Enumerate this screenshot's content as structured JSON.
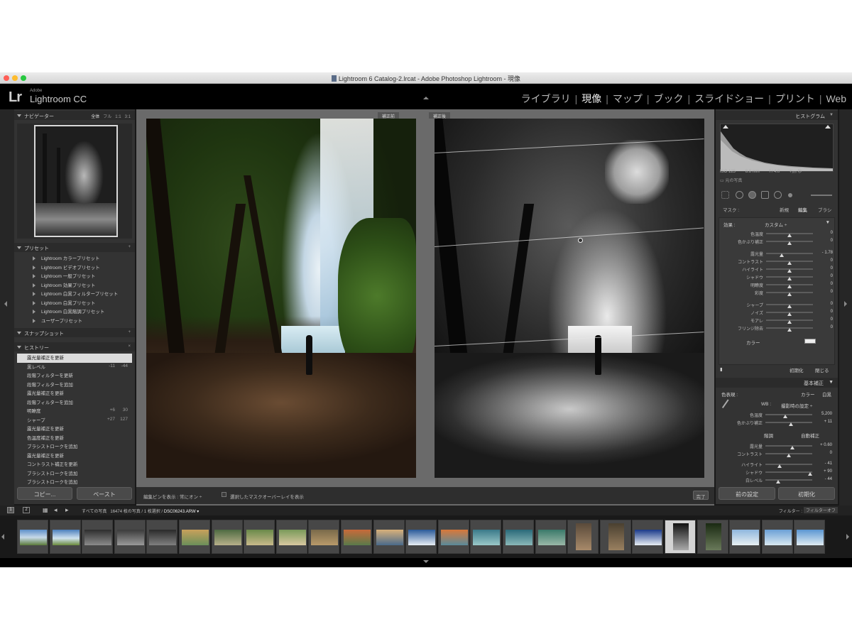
{
  "window": {
    "title": "Lightroom 6 Catalog-2.lrcat - Adobe Photoshop Lightroom - 現像",
    "traffic_colors": [
      "#ff5f57",
      "#febc2e",
      "#28c840"
    ]
  },
  "identity": {
    "logo": "Lr",
    "adobe": "Adobe",
    "product": "Lightroom CC"
  },
  "modules": [
    "ライブラリ",
    "現像",
    "マップ",
    "ブック",
    "スライドショー",
    "プリント",
    "Web"
  ],
  "active_module": "現像",
  "navigator": {
    "title": "ナビゲーター",
    "zoom": [
      "全体",
      "フル",
      "1:1",
      "3:1"
    ]
  },
  "presets": {
    "title": "プリセット",
    "items": [
      "Lightroom カラープリセット",
      "Lightroom ビデオプリセット",
      "Lightroom 一般プリセット",
      "Lightroom 効果プリセット",
      "Lightroom 白黒フィルタープリセット",
      "Lightroom 白黒プリセット",
      "Lightroom 白黒階調プリセット",
      "ユーザープリセット"
    ]
  },
  "snapshot": {
    "title": "スナップショット"
  },
  "history": {
    "title": "ヒストリー",
    "items": [
      {
        "label": "露光量補正を更新",
        "v1": "",
        "v2": "",
        "selected": true
      },
      {
        "label": "黒レベル",
        "v1": "-11",
        "v2": "-44"
      },
      {
        "label": "段階フィルターを更新",
        "v1": "",
        "v2": ""
      },
      {
        "label": "段階フィルターを追加",
        "v1": "",
        "v2": ""
      },
      {
        "label": "露光量補正を更新",
        "v1": "",
        "v2": ""
      },
      {
        "label": "段階フィルターを追加",
        "v1": "",
        "v2": ""
      },
      {
        "label": "明瞭度",
        "v1": "+6",
        "v2": "30"
      },
      {
        "label": "シャープ",
        "v1": "+27",
        "v2": "127"
      },
      {
        "label": "露光量補正を更新",
        "v1": "",
        "v2": ""
      },
      {
        "label": "色温度補正を更新",
        "v1": "",
        "v2": ""
      },
      {
        "label": "ブラシストロークを追加",
        "v1": "",
        "v2": ""
      },
      {
        "label": "露光量補正を更新",
        "v1": "",
        "v2": ""
      },
      {
        "label": "コントラスト補正を更新",
        "v1": "",
        "v2": ""
      },
      {
        "label": "ブラシストロークを追加",
        "v1": "",
        "v2": ""
      },
      {
        "label": "ブラシストロークを追加",
        "v1": "",
        "v2": ""
      }
    ]
  },
  "left_buttons": {
    "copy": "コピー...",
    "paste": "ペースト"
  },
  "view": {
    "before_label": "補正前",
    "after_label": "補正後"
  },
  "toolbar": {
    "pins_label": "編集ピンを表示 :",
    "pins_value": "常にオン ÷",
    "overlay_label": "選択したマスクオーバーレイを表示",
    "done": "完了"
  },
  "histogram": {
    "title": "ヒストグラム",
    "iso": "ISO 125",
    "focal": "8.8 mm",
    "aperture": "f / 4.0",
    "shutter": "¹⁄₁₆₀ 秒",
    "orig": "元の写真"
  },
  "mask": {
    "label": "マスク :",
    "new": "新規",
    "edit": "編集",
    "brush": "ブラシ"
  },
  "effect": {
    "label": "効果 :",
    "preset": "カスタム ÷",
    "sliders": [
      {
        "label": "色温度",
        "value": "0",
        "pos": 0.5,
        "group": 1
      },
      {
        "label": "色かぶり補正",
        "value": "0",
        "pos": 0.5,
        "group": 1
      },
      {
        "label": "露光量",
        "value": "- 1.78",
        "pos": 0.34,
        "group": 2
      },
      {
        "label": "コントラスト",
        "value": "0",
        "pos": 0.5,
        "group": 2
      },
      {
        "label": "ハイライト",
        "value": "0",
        "pos": 0.5,
        "group": 2
      },
      {
        "label": "シャドウ",
        "value": "0",
        "pos": 0.5,
        "group": 2
      },
      {
        "label": "明瞭度",
        "value": "0",
        "pos": 0.5,
        "group": 2
      },
      {
        "label": "彩度",
        "value": "0",
        "pos": 0.5,
        "group": 2
      },
      {
        "label": "シャープ",
        "value": "0",
        "pos": 0.5,
        "group": 3
      },
      {
        "label": "ノイズ",
        "value": "0",
        "pos": 0.5,
        "group": 3
      },
      {
        "label": "モアレ",
        "value": "0",
        "pos": 0.5,
        "group": 3
      },
      {
        "label": "フリンジ除去",
        "value": "0",
        "pos": 0.5,
        "group": 3
      }
    ],
    "color_label": "カラー",
    "reset": "初期化",
    "close": "閉じる"
  },
  "basic": {
    "title": "基本補正",
    "treatment": "色表現 :",
    "color": "カラー",
    "bw": "白黒",
    "wb_label": "WB :",
    "wb_value": "撮影時の設定 ÷",
    "sliders_a": [
      {
        "label": "色温度",
        "value": "5,200",
        "pos": 0.42
      },
      {
        "label": "色かぶり補正",
        "value": "+ 11",
        "pos": 0.55
      }
    ],
    "tone_label": "階調",
    "auto": "自動補正",
    "sliders_b": [
      {
        "label": "露光量",
        "value": "+ 0.60",
        "pos": 0.58
      },
      {
        "label": "コントラスト",
        "value": "0",
        "pos": 0.5
      }
    ],
    "sliders_c": [
      {
        "label": "ハイライト",
        "value": "- 41",
        "pos": 0.3
      },
      {
        "label": "シャドウ",
        "value": "+ 90",
        "pos": 0.95
      },
      {
        "label": "白レベル",
        "value": "- 44",
        "pos": 0.28
      }
    ]
  },
  "right_buttons": {
    "prev": "前の設定",
    "reset": "初期化"
  },
  "filmstrip_bar": {
    "page1": "1",
    "page2": "2",
    "path_prefix": "すべての写真",
    "path_count": "16474 枚の写真 / 1 枚選択 /",
    "path_file": "DSC06243.ARW ▾",
    "filter_label": "フィルター :",
    "filter_value": "フィルターオフ"
  }
}
